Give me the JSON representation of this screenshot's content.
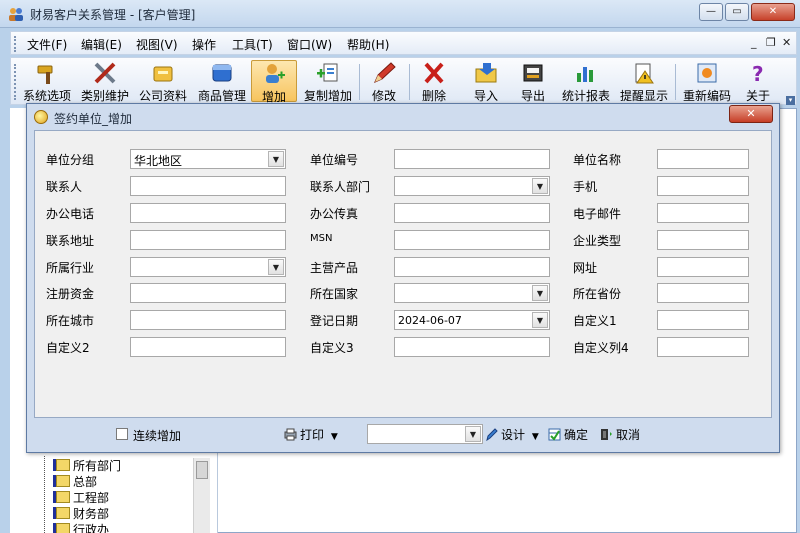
{
  "window": {
    "title": "财易客户关系管理 - [客户管理]",
    "minimize": "—",
    "restore": "▭",
    "close": "✕"
  },
  "menu": {
    "items": [
      "文件(F)",
      "编辑(E)",
      "视图(V)",
      "操作",
      "工具(T)",
      "窗口(W)",
      "帮助(H)"
    ],
    "mdi_min": "_",
    "mdi_restore": "❐",
    "mdi_close": "✕"
  },
  "toolbar": {
    "buttons": [
      {
        "label": "系统选项",
        "icon": "hammer-icon"
      },
      {
        "label": "类别维护",
        "icon": "tools-icon"
      },
      {
        "label": "公司资料",
        "icon": "company-icon"
      },
      {
        "label": "商品管理",
        "icon": "box-icon"
      },
      {
        "label": "增加",
        "icon": "add-user-icon"
      },
      {
        "label": "复制增加",
        "icon": "copy-add-icon"
      },
      {
        "label": "修改",
        "icon": "pencil-icon"
      },
      {
        "label": "删除",
        "icon": "delete-x-icon"
      },
      {
        "label": "导入",
        "icon": "import-icon"
      },
      {
        "label": "导出",
        "icon": "export-icon"
      },
      {
        "label": "统计报表",
        "icon": "bar-chart-icon"
      },
      {
        "label": "提醒显示",
        "icon": "reminder-icon"
      },
      {
        "label": "重新编码",
        "icon": "recode-icon"
      },
      {
        "label": "关于",
        "icon": "question-icon"
      }
    ]
  },
  "tree": {
    "items": [
      "所有部门",
      "总部",
      "工程部",
      "财务部",
      "行政办"
    ]
  },
  "dialog": {
    "title": "签约单位_增加",
    "close": "✕",
    "fields": {
      "group_label": "单位分组",
      "group_value": "华北地区",
      "code_label": "单位编号",
      "code_value": "",
      "name_label": "单位名称",
      "name_value": "",
      "contact_label": "联系人",
      "contact_value": "",
      "contact_dept_label": "联系人部门",
      "contact_dept_value": "",
      "mobile_label": "手机",
      "mobile_value": "",
      "office_phone_label": "办公电话",
      "office_phone_value": "",
      "fax_label": "办公传真",
      "fax_value": "",
      "email_label": "电子邮件",
      "email_value": "",
      "address_label": "联系地址",
      "address_value": "",
      "msn_label": "MSN",
      "msn_value": "",
      "company_type_label": "企业类型",
      "company_type_value": "",
      "industry_label": "所属行业",
      "industry_value": "",
      "main_product_label": "主营产品",
      "main_product_value": "",
      "website_label": "网址",
      "website_value": "",
      "capital_label": "注册资金",
      "capital_value": "",
      "country_label": "所在国家",
      "country_value": "",
      "province_label": "所在省份",
      "province_value": "",
      "city_label": "所在城市",
      "city_value": "",
      "reg_date_label": "登记日期",
      "reg_date_value": "2024-06-07",
      "custom1_label": "自定义1",
      "custom1_value": "",
      "custom2_label": "自定义2",
      "custom2_value": "",
      "custom3_label": "自定义3",
      "custom3_value": "",
      "custom4_label": "自定义列4",
      "custom4_value": ""
    },
    "footer": {
      "continuous_add": "连续增加",
      "print": "打印",
      "design": "设计",
      "ok": "确定",
      "cancel": "取消"
    }
  },
  "colors": {
    "accent": "#f7c45e",
    "titlebar": "#c3d7ee",
    "dialog_bg": "#cfdcee",
    "close_red": "#c63e27"
  }
}
